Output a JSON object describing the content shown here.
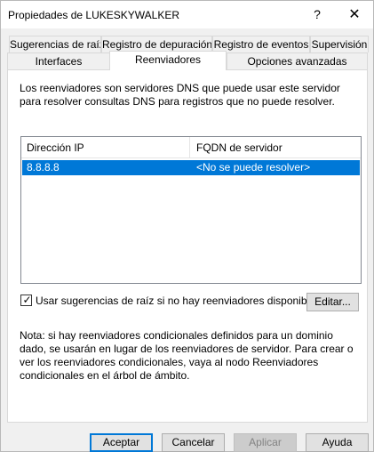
{
  "window": {
    "title": "Propiedades de LUKESKYWALKER",
    "help_glyph": "?",
    "close_glyph": "✕"
  },
  "tabs": {
    "row1": [
      {
        "label": "Sugerencias de raíz"
      },
      {
        "label": "Registro de depuración"
      },
      {
        "label": "Registro de eventos"
      },
      {
        "label": "Supervisión"
      }
    ],
    "row2": [
      {
        "label": "Interfaces"
      },
      {
        "label": "Reenviadores",
        "active": true
      },
      {
        "label": "Opciones avanzadas"
      }
    ]
  },
  "panel": {
    "description": "Los reenviadores son servidores DNS que puede usar este servidor para resolver consultas DNS para registros que no puede resolver.",
    "list": {
      "columns": [
        "Dirección IP",
        "FQDN de servidor"
      ],
      "rows": [
        {
          "ip": "8.8.8.8",
          "fqdn": "<No se puede resolver>",
          "selected": true
        }
      ]
    },
    "use_root_hints": {
      "label": "Usar sugerencias de raíz si no hay reenviadores disponibles",
      "checked": true,
      "check_glyph": "✓"
    },
    "edit_button": "Editar...",
    "note": "Nota: si hay reenviadores condicionales definidos para un dominio dado, se usarán en lugar de los reenviadores de servidor. Para crear o ver los reenviadores condicionales, vaya al nodo Reenviadores condicionales en el árbol de ámbito."
  },
  "buttons": {
    "ok": "Aceptar",
    "cancel": "Cancelar",
    "apply": "Aplicar",
    "help": "Ayuda"
  },
  "colors": {
    "selection": "#0078d7",
    "default_button_border": "#0078d7"
  }
}
